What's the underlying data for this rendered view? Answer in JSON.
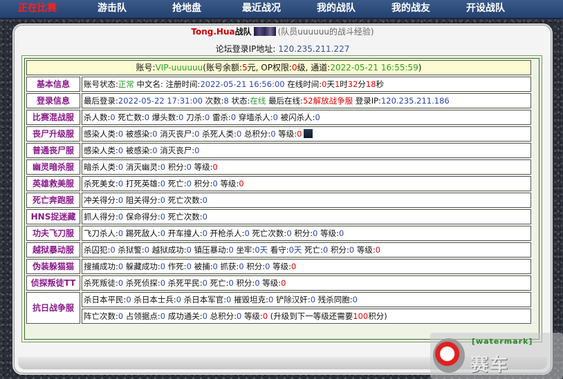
{
  "nav": [
    {
      "label": "正在比赛",
      "active": true
    },
    {
      "label": "游击队"
    },
    {
      "label": "抢地盘"
    },
    {
      "label": "最近战况"
    },
    {
      "label": "我的战队"
    },
    {
      "label": "我的战友"
    },
    {
      "label": "开设战队"
    }
  ],
  "team": {
    "name": "Tong.Hua",
    "suffix": "战队",
    "note": "(队员uuuuuu的战斗经验)"
  },
  "ip_line": {
    "label": "论坛登录IP地址:",
    "value": "120.235.211.227"
  },
  "account": {
    "prefix": "账号:",
    "vip": "VIP-uuuuuu",
    "balance_label": "(账号余额:",
    "balance": "5",
    "balance_unit": "元, OP权限:",
    "op": "0",
    "op_unit": "级, 通道:",
    "channel_time": "2022-05-21 16:55:59",
    "close": ")"
  },
  "rows": {
    "basic": {
      "label": "基本信息",
      "status_label": "账号状态:",
      "status": "正常",
      "cn_label": "中文名:",
      "cn_value": "",
      "reg_label": "注册时间:",
      "reg_time": "2022-05-21 16:56:00",
      "online_label": "在线时间:",
      "d": "0",
      "d_unit": "天",
      "h": "1",
      "h_unit": "时",
      "m": "32",
      "m_unit": "分",
      "s": "18",
      "s_unit": "秒"
    },
    "login": {
      "label": "登录信息",
      "last_label": "最后登录:",
      "last_time": "2022-05-22 17:31:00",
      "count_label": "次数:",
      "count": "8",
      "st_label": "状态:",
      "status": "在线",
      "srv_label": "最后在线:",
      "server": "52解放战争服",
      "ip_label": "登录IP:",
      "ip": "120.235.211.186"
    },
    "mix": {
      "label": "比赛混战服",
      "parts": [
        "杀人数:",
        "0",
        "死亡数:",
        "0",
        "爆头数:",
        "0",
        "刀杀:",
        "0",
        "雷杀:",
        "0",
        "穿墙杀人:",
        "0",
        "被闪杀人:",
        "0"
      ]
    },
    "zombie_up": {
      "label": "丧尸升级服",
      "parts": [
        "感染人类:",
        "0",
        "被感染:",
        "0",
        "消灭丧尸:",
        "0",
        "杀死人类:",
        "0",
        "总积分:",
        "0",
        "等级:"
      ],
      "level": "0"
    },
    "zombie": {
      "label": "普通丧尸服",
      "parts": [
        "感染人类:",
        "0",
        "被感染:",
        "0",
        "消灭丧尸:",
        "0"
      ]
    },
    "ghost": {
      "label": "幽灵暗杀服",
      "parts": [
        "暗杀人类:",
        "0",
        "消灭幽灵:",
        "0",
        "积分:",
        "0",
        "等级:"
      ],
      "level": "0"
    },
    "hero": {
      "label": "英雄救美服",
      "parts": [
        "杀死美女:",
        "0",
        "打死英雄:",
        "0",
        "死亡:",
        "0",
        "积分:",
        "0",
        "等级:"
      ],
      "level": "0"
    },
    "death_run": {
      "label": "死亡奔跑服",
      "parts": [
        "冲关得分:",
        "0",
        "阻关得分:",
        "0",
        "死亡次数:",
        "0"
      ]
    },
    "hns": {
      "label": "HNS捉迷藏",
      "parts": [
        "抓人得分:",
        "0",
        "保命得分:",
        "0",
        "死亡次数:",
        "0"
      ]
    },
    "kungfu": {
      "label": "功夫飞刀服",
      "parts": [
        "飞刀杀人:",
        "0",
        "踢死敌人:",
        "0",
        "开车撞人:",
        "0",
        "开枪杀人:",
        "0",
        "死亡次数:",
        "0",
        "积分:",
        "0",
        "等级:",
        "0"
      ]
    },
    "jail": {
      "label": "越狱暴动服",
      "parts": [
        "杀囚犯:",
        "0",
        "杀狱警:",
        "0",
        "越狱成功:",
        "0",
        "镇压暴动:",
        "0",
        "坐牢:"
      ],
      "jail_days": "0",
      "jail_unit": "天",
      "guard_label": "看守:",
      "guard_days": "0",
      "guard_unit": "天",
      "tail": [
        "死亡:",
        "0",
        "积分:",
        "0",
        "等级:"
      ],
      "level": "0"
    },
    "hide": {
      "label": "伪装躲猫猫",
      "parts": [
        "搜捕成功:",
        "0",
        "躲藏成功:",
        "0",
        "作死:",
        "0",
        "被捕:",
        "0",
        "抓获:",
        "0",
        "积分:",
        "0",
        "等级:"
      ],
      "level": "0"
    },
    "detective": {
      "label": "侦探叛徒TT",
      "parts": [
        "杀死叛徒:",
        "0",
        "杀死侦探:",
        "0",
        "杀死平民:",
        "0",
        "死亡:",
        "0",
        "积分:",
        "0",
        "等级:"
      ],
      "level": "0"
    },
    "war": {
      "label": "抗日战争服",
      "line1": [
        "杀日本平民:",
        "0",
        "杀日本士兵:",
        "0",
        "杀日本军官:",
        "0",
        "摧毁坦克:",
        "0",
        "铲除汉奸:",
        "0",
        "残杀同胞:",
        "0"
      ],
      "line2": [
        "阵亡次数:",
        "0",
        "占领据点:",
        "0",
        "成功通关:",
        "0",
        "总积分:",
        "0",
        "等级:"
      ],
      "level": "0",
      "upgrade_pre": "(升级到下一等级还需要",
      "upgrade_pts": "100",
      "upgrade_post": "积分)"
    }
  },
  "watermark": {
    "line1": "[watermark]",
    "line2": "赛车"
  },
  "colors": {
    "nav_bg": "#24416e",
    "active": "#ff2020",
    "label": "#8a1a8a",
    "value_blue": "#2a46a8",
    "value_red": "#dd0000",
    "green": "#2aa02a"
  }
}
